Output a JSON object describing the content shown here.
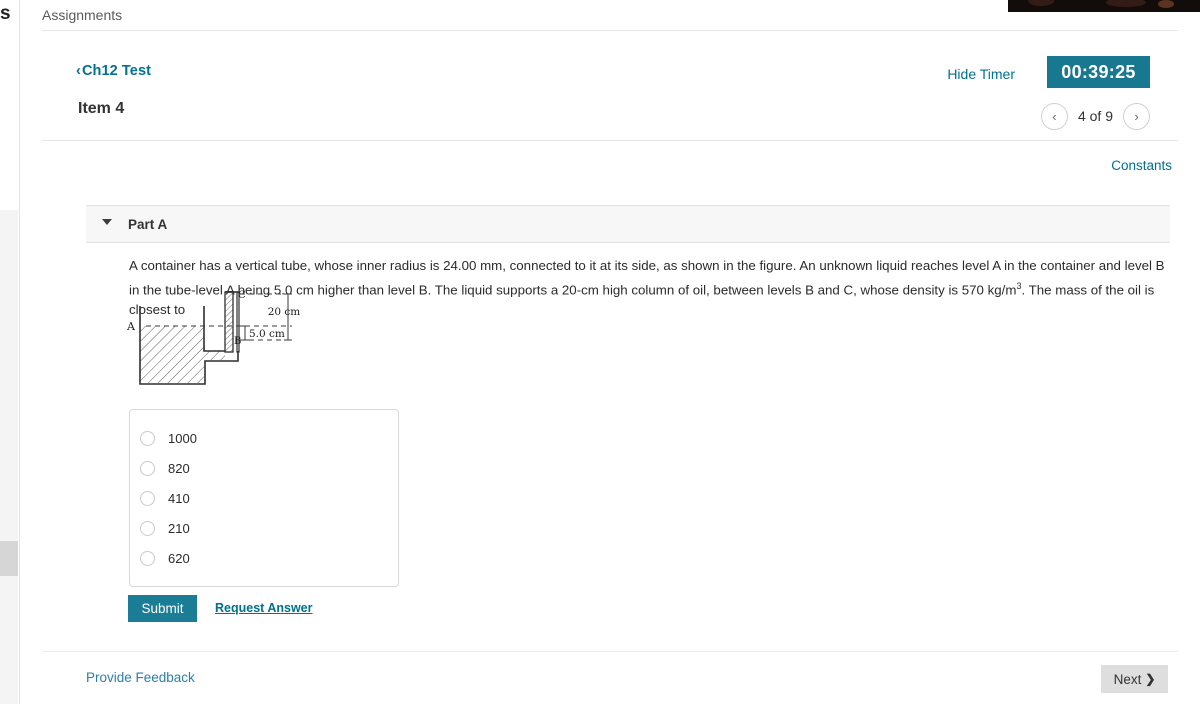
{
  "breadcrumb": {
    "label": "Assignments"
  },
  "sidebar": {
    "cut_label": "s"
  },
  "assignment": {
    "back_chevron": "‹",
    "back_label": "Ch12 Test",
    "item_title": "Item 4",
    "hide_timer_label": "Hide Timer",
    "timer_value": "00:39:25",
    "prev_icon": "‹",
    "next_icon": "›",
    "page_count": "4 of 9",
    "constants_label": "Constants"
  },
  "part": {
    "caret_icon": "caret-down-icon",
    "label": "Part A"
  },
  "question": {
    "text_part1": "A container has a vertical tube, whose inner radius is 24.00 mm, connected to it at its side, as shown in the figure. An unknown liquid reaches level A in the container and level B in the tube-level A being 5.0 cm higher than level B. The liquid supports a 20-cm high column of oil, between levels B and C, whose density is 570 kg/m",
    "exponent": "3",
    "text_part2": ". The mass of the oil is closest to"
  },
  "figure": {
    "label_a": "A",
    "label_b": "B",
    "label_c": "C",
    "dim_outer": "20 cm",
    "dim_inner": "5.0 cm"
  },
  "options": [
    {
      "value": "1000",
      "selected": false
    },
    {
      "value": "820",
      "selected": false
    },
    {
      "value": "410",
      "selected": false
    },
    {
      "value": "210",
      "selected": false
    },
    {
      "value": "620",
      "selected": false
    }
  ],
  "actions": {
    "submit_label": "Submit",
    "request_answer_label": "Request Answer",
    "provide_feedback_label": "Provide Feedback",
    "next_label": "Next",
    "next_chevron": "❯"
  },
  "colors": {
    "accent_teal": "#18788f",
    "link_teal": "#00718e",
    "next_gray": "#dedede"
  }
}
